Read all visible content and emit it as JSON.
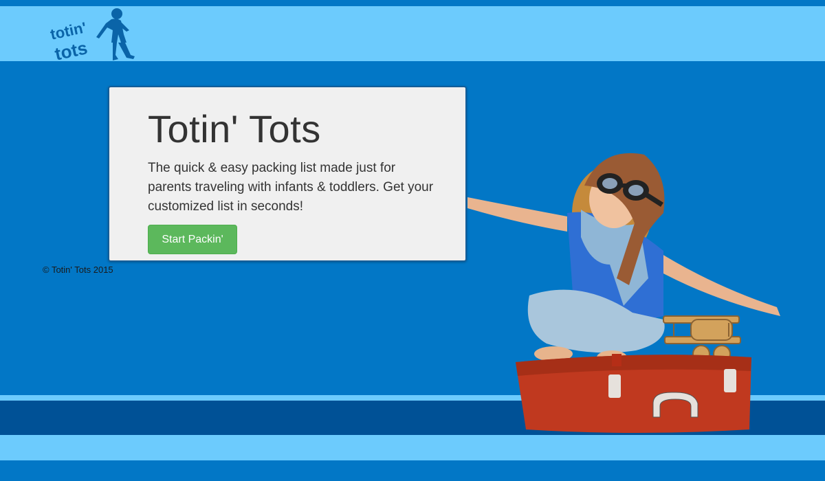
{
  "brand": {
    "logo_text": "totin' tots",
    "logo_icon": "walking-child-silhouette-icon",
    "colors": {
      "header_band": "#6ccbfd",
      "page_background": "#0277c6",
      "footer_band_dark": "#005196",
      "button_green": "#5cb85c"
    }
  },
  "hero": {
    "title": "Totin' Tots",
    "description": "The quick & easy packing list made just for parents traveling with infants & toddlers. Get your customized list in seconds!",
    "cta_label": "Start Packin'",
    "image": "child-pilot-on-suitcase-photo"
  },
  "footer": {
    "copyright": "© Totin' Tots 2015"
  }
}
